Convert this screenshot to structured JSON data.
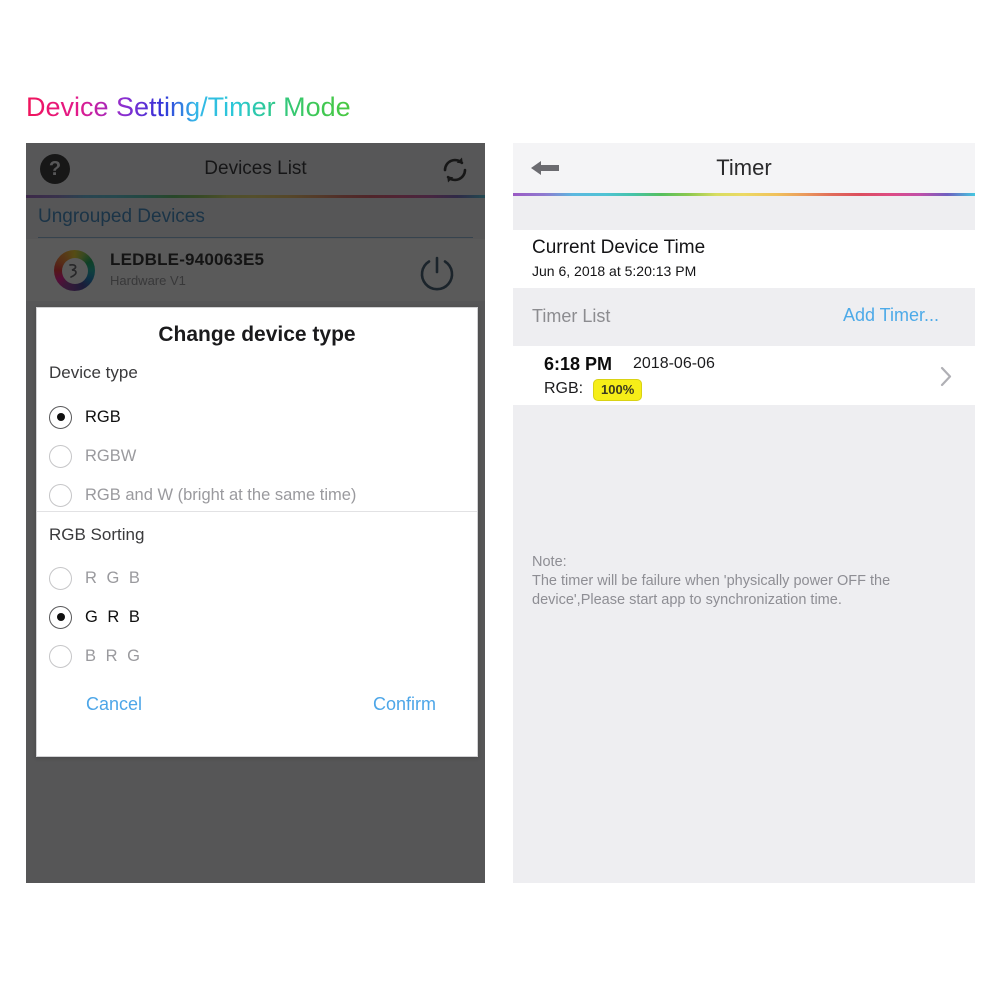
{
  "page": {
    "title": "Device Setting/Timer Mode"
  },
  "colors": {
    "link_blue": "#4daae8",
    "badge_yellow": "#f6ee18",
    "section_blue": "#2c7fc0",
    "overlay": "rgba(20,20,20,0.70)"
  },
  "left_panel": {
    "navbar": {
      "title": "Devices List",
      "help_icon": "question-mark-icon",
      "help_glyph": "?",
      "refresh_icon": "refresh-sync-icon"
    },
    "group_header": {
      "label": "Ungrouped Devices"
    },
    "device": {
      "logo_icon": "rgb-color-wheel-icon",
      "name": "LEDBLE-940063E5",
      "hardware": "Hardware V1",
      "power_icon": "power-button-icon"
    },
    "modal": {
      "title": "Change device type",
      "device_type_label": "Device type",
      "device_type_options": [
        {
          "label": "RGB",
          "checked": true
        },
        {
          "label": "RGBW",
          "checked": false
        },
        {
          "label": "RGB and W (bright at the same time)",
          "checked": false
        }
      ],
      "rgb_sorting_label": "RGB Sorting",
      "rgb_sorting_options": [
        {
          "label": "R G B",
          "checked": false
        },
        {
          "label": "G R B",
          "checked": true
        },
        {
          "label": "B R G",
          "checked": false
        }
      ],
      "cancel_label": "Cancel",
      "confirm_label": "Confirm"
    }
  },
  "right_panel": {
    "navbar": {
      "title": "Timer",
      "back_icon": "back-arrow-icon"
    },
    "current_device_time": {
      "title": "Current Device Time",
      "value": "Jun 6, 2018 at 5:20:13 PM"
    },
    "timer_list": {
      "label": "Timer List",
      "add_label": "Add Timer...",
      "rows": [
        {
          "time": "6:18 PM",
          "date": "2018-06-06",
          "channel_label": "RGB:",
          "badge": "100%",
          "chevron_icon": "chevron-right-icon"
        }
      ]
    },
    "note": {
      "line1": "Note:",
      "line2": "The timer will be failure when 'physically power OFF the",
      "line3": "device',Please start app to synchronization time."
    }
  }
}
